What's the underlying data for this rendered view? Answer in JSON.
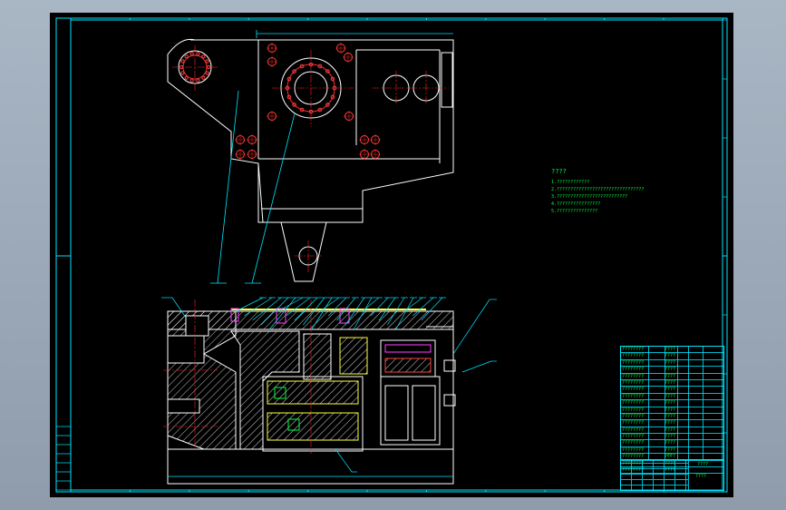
{
  "colors": {
    "background": "#000000",
    "frame": "#00e5ff",
    "outline": "#ffffff",
    "centerline": "#ff2020",
    "leader": "#00e5ff",
    "hatch": "#ffffff",
    "callout_hole": "#ff3030",
    "accent_yellow": "#ffff40",
    "accent_green": "#00ff40",
    "accent_magenta": "#ff40ff",
    "notes_text": "#00ff40",
    "table_text": "#00ff40"
  },
  "notes": {
    "title": "????",
    "lines": [
      "1.????????????",
      "2.????????????????????????????????",
      "3.??????????????????????????",
      "4.????????????????",
      "5.???????????????"
    ]
  },
  "title_block": {
    "rows": [
      "????????",
      "????????",
      "????????",
      "????????",
      "????????",
      "????????",
      "????????",
      "????????",
      "????????",
      "????????",
      "????????",
      "????????",
      "????????",
      "????????",
      "????????",
      "????????",
      "????????",
      "????????",
      "????????"
    ],
    "name_cell": "????",
    "drawing_no": "????",
    "sign": "??"
  },
  "icons": [
    "frame-border-icon",
    "crosshair-icon",
    "bolt-circle-icon",
    "hatch-section-icon"
  ]
}
